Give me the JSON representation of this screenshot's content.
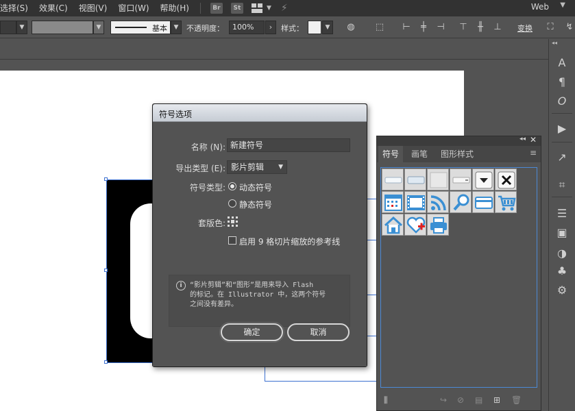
{
  "menubar": {
    "items": [
      "选择(S)",
      "效果(C)",
      "视图(V)",
      "窗口(W)",
      "帮助(H)"
    ],
    "badges": [
      "Br",
      "St"
    ],
    "workspace": "Web"
  },
  "controlbar": {
    "stroke_label": "基本",
    "opacity_label": "不透明度：",
    "opacity_value": "100%",
    "style_label": "样式：",
    "transform_label": "变换"
  },
  "symbols_panel": {
    "tabs": [
      "符号",
      "画笔",
      "图形样式"
    ],
    "active_tab": "符号",
    "symbols": [
      "button-flat",
      "button-gradient",
      "button-blank",
      "text-field",
      "dropdown-arrow",
      "close-x",
      "calendar",
      "film-frame",
      "rss-feed",
      "magnifier",
      "credit-card",
      "shopping-cart",
      "home",
      "heart-plus",
      "printer"
    ]
  },
  "dialog": {
    "title": "符号选项",
    "name_label": "名称 (N):",
    "name_value": "新建符号",
    "export_label": "导出类型 (E):",
    "export_value": "影片剪辑",
    "symbol_type_label": "符号类型:",
    "dynamic_label": "动态符号",
    "static_label": "静态符号",
    "registration_label": "套版色:",
    "nine_slice_label": "启用 9 格切片缩放的参考线",
    "info_lines": [
      "“影片剪辑”和“图形”是用来导入 Flash",
      "的标记。在 Illustrator 中，这两个符号",
      "之间没有差异。"
    ],
    "ok_label": "确定",
    "cancel_label": "取消"
  }
}
